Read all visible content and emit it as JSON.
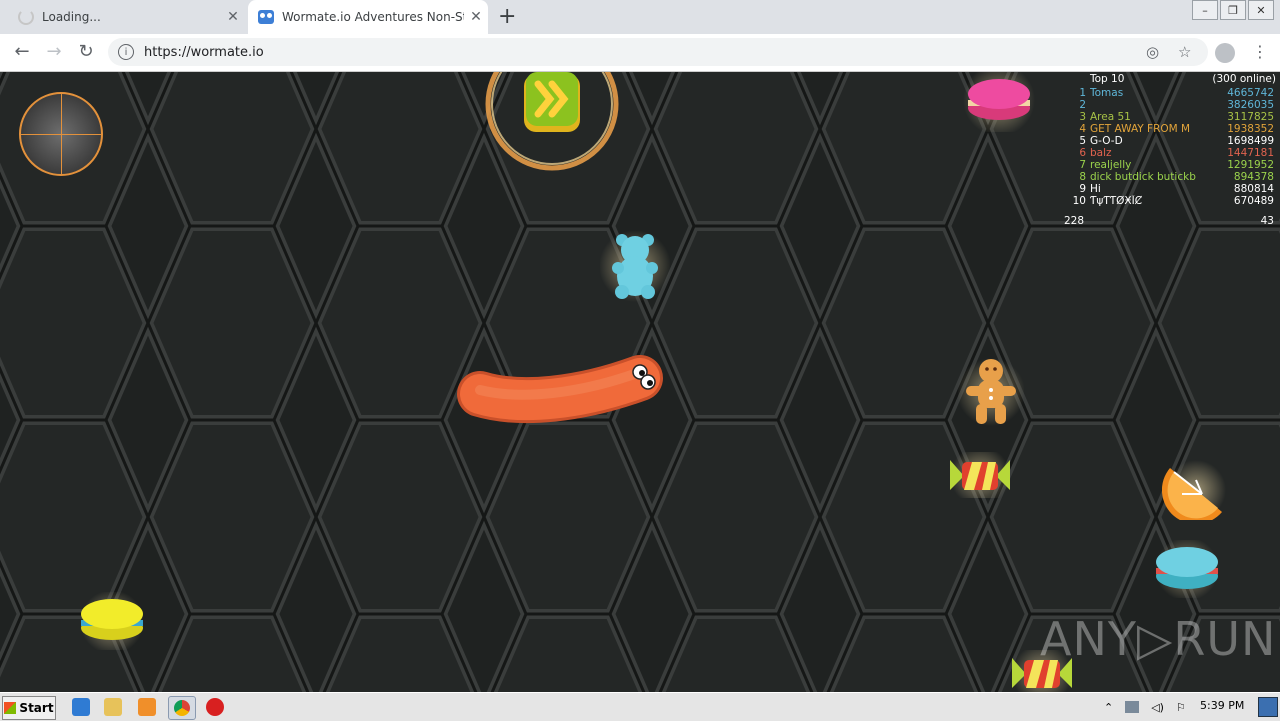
{
  "browser": {
    "tabs": [
      {
        "title": "Loading...",
        "active": false
      },
      {
        "title": "Wormate.io Adventures Non-Stop",
        "active": true
      }
    ],
    "url": "https://wormate.io",
    "window_controls": {
      "minimize": "–",
      "restore": "❐",
      "close": "✕"
    },
    "icons": {
      "back": "←",
      "forward": "→",
      "reload": "↻",
      "location": "◎",
      "bookmark": "☆",
      "menu": "⋮",
      "new_tab": "+",
      "tab_close": "✕"
    }
  },
  "game": {
    "leaderboard": {
      "title": "Top 10",
      "online": "(300 online)",
      "entries": [
        {
          "rank": "1",
          "name": "Tomas",
          "score": "4665742",
          "color": "#5fb6d8"
        },
        {
          "rank": "2",
          "name": "",
          "score": "3826035",
          "color": "#5fb6d8"
        },
        {
          "rank": "3",
          "name": "Area 51",
          "score": "3117825",
          "color": "#a7c246"
        },
        {
          "rank": "4",
          "name": "GET AWAY FROM M",
          "score": "1938352",
          "color": "#e2a43a"
        },
        {
          "rank": "5",
          "name": "G-O-D",
          "score": "1698499",
          "color": "#ffffff"
        },
        {
          "rank": "6",
          "name": "balz",
          "score": "1447181",
          "color": "#e2634f"
        },
        {
          "rank": "7",
          "name": "realjelly",
          "score": "1291952",
          "color": "#9bd34c"
        },
        {
          "rank": "8",
          "name": "dick butdick butickb",
          "score": "894378",
          "color": "#9bd34c"
        },
        {
          "rank": "9",
          "name": "Hi",
          "score": "880814",
          "color": "#ffffff"
        },
        {
          "rank": "10",
          "name": "ƬψƬƬØӾĪȻ",
          "score": "670489",
          "color": "#ffffff"
        }
      ],
      "my_position": "228",
      "my_score": "43"
    },
    "watermark": "ANY▷RUN",
    "worm_color": "#f06a3a",
    "accent": "#e3913b"
  },
  "taskbar": {
    "start_label": "Start",
    "clock": "5:39 PM",
    "tray_icons": [
      "chevron-up-icon",
      "network-icon",
      "volume-icon",
      "flag-icon"
    ]
  }
}
